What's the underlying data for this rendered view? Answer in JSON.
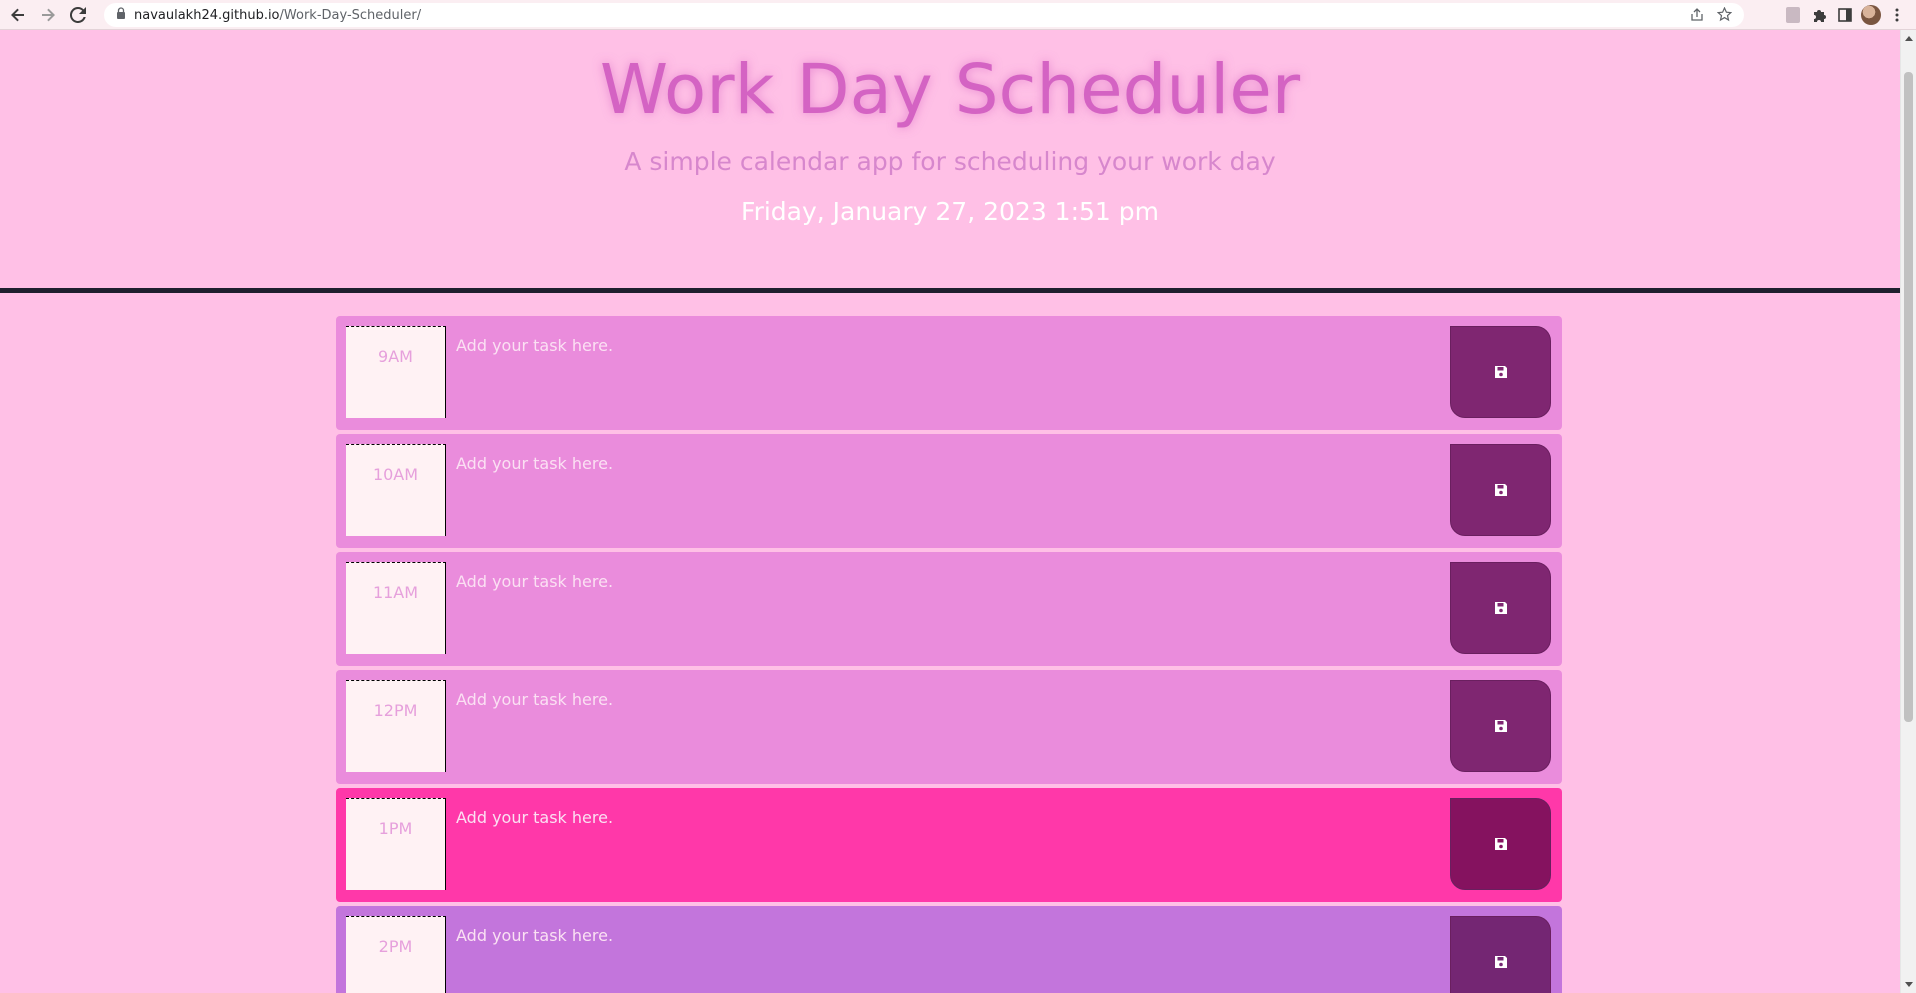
{
  "browser": {
    "url_host": "navaulakh24.github.io",
    "url_path": "/Work-Day-Scheduler/"
  },
  "header": {
    "title": "Work Day Scheduler",
    "subtitle": "A simple calendar app for scheduling your work day",
    "current_day": "Friday, January 27, 2023 1:51 pm"
  },
  "colors": {
    "past": "#ea8cdc",
    "present": "#ff38a9",
    "future": "#c375dc",
    "save_button": "#7f2671"
  },
  "time_blocks": [
    {
      "hour": "9AM",
      "status": "past",
      "placeholder": "Add your task here.",
      "value": ""
    },
    {
      "hour": "10AM",
      "status": "past",
      "placeholder": "Add your task here.",
      "value": ""
    },
    {
      "hour": "11AM",
      "status": "past",
      "placeholder": "Add your task here.",
      "value": ""
    },
    {
      "hour": "12PM",
      "status": "past",
      "placeholder": "Add your task here.",
      "value": ""
    },
    {
      "hour": "1PM",
      "status": "present",
      "placeholder": "Add your task here.",
      "value": ""
    },
    {
      "hour": "2PM",
      "status": "future",
      "placeholder": "Add your task here.",
      "value": ""
    }
  ],
  "icons": {
    "save": "floppy-disk-icon"
  }
}
